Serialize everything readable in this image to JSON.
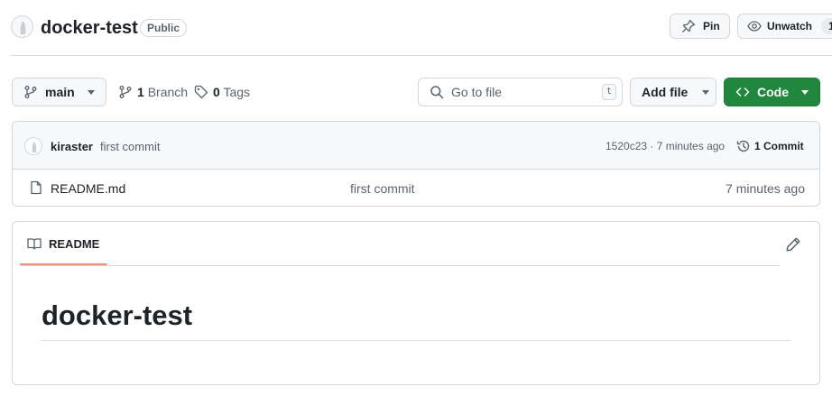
{
  "repo": {
    "name": "docker-test",
    "visibility": "Public"
  },
  "header_actions": {
    "pin_label": "Pin",
    "unwatch_label": "Unwatch",
    "watch_count": "1"
  },
  "toolbar": {
    "branch_name": "main",
    "branch_count": "1",
    "branch_label": "Branch",
    "tag_count": "0",
    "tag_label": "Tags",
    "search_placeholder": "Go to file",
    "search_shortcut": "t",
    "add_file_label": "Add file",
    "code_label": "Code"
  },
  "latest_commit": {
    "author": "kiraster",
    "message": "first commit",
    "sha_and_time": "1520c23 · 7 minutes ago",
    "commits_label": "1 Commit"
  },
  "files": [
    {
      "name": "README.md",
      "message": "first commit",
      "age": "7 minutes ago"
    }
  ],
  "readme": {
    "tab_label": "README",
    "heading": "docker-test"
  },
  "colors": {
    "primary_button": "#1f883d",
    "tab_underline": "#fd8c73",
    "border": "#d0d7de"
  },
  "icons": [
    "avatar-icon",
    "pin-icon",
    "eye-icon",
    "branch-icon",
    "tag-icon",
    "search-icon",
    "code-icon",
    "history-icon",
    "file-icon",
    "book-icon",
    "pencil-icon"
  ]
}
